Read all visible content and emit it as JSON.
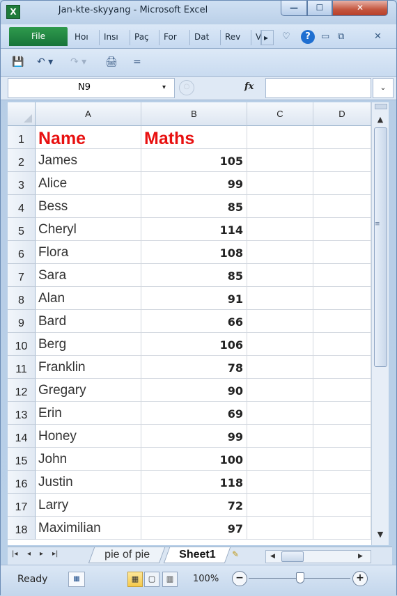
{
  "window": {
    "title": "Jan-kte-skyyang  -  Microsoft Excel",
    "app_icon": "X",
    "min_glyph": "—",
    "max_glyph": "☐",
    "close_glyph": "✕"
  },
  "ribbon": {
    "file_label": "File",
    "tabs": [
      "Hoı",
      "Insı",
      "Paç",
      "For",
      "Dat",
      "Rev",
      "Vı"
    ],
    "tab_more": "▸",
    "minimize_ribbon": "♡",
    "help_glyph": "?",
    "restore_glyphs": [
      "▭",
      "⧉",
      "✕"
    ]
  },
  "qat": {
    "save": "💾",
    "undo": "↶ ▾",
    "redo": "↷ ▾",
    "print": "🖨",
    "customize": "="
  },
  "formula_bar": {
    "name_box": "N9",
    "name_box_arrow": "▾",
    "fx_label": "fx",
    "formula": "",
    "expand_glyph": "⌄",
    "cancel_glyph": "○"
  },
  "columns": [
    "A",
    "B",
    "C",
    "D"
  ],
  "rows": [
    {
      "n": "1",
      "A": "Name",
      "B": "Maths"
    },
    {
      "n": "2",
      "A": "James",
      "B": "105"
    },
    {
      "n": "3",
      "A": "Alice",
      "B": "99"
    },
    {
      "n": "4",
      "A": "Bess",
      "B": "85"
    },
    {
      "n": "5",
      "A": "Cheryl",
      "B": "114"
    },
    {
      "n": "6",
      "A": "Flora",
      "B": "108"
    },
    {
      "n": "7",
      "A": "Sara",
      "B": "85"
    },
    {
      "n": "8",
      "A": "Alan",
      "B": "91"
    },
    {
      "n": "9",
      "A": "Bard",
      "B": "66"
    },
    {
      "n": "10",
      "A": "Berg",
      "B": "106"
    },
    {
      "n": "11",
      "A": "Franklin",
      "B": "78"
    },
    {
      "n": "12",
      "A": "Gregary",
      "B": "90"
    },
    {
      "n": "13",
      "A": "Erin",
      "B": "69"
    },
    {
      "n": "14",
      "A": "Honey",
      "B": "99"
    },
    {
      "n": "15",
      "A": "John",
      "B": "100"
    },
    {
      "n": "16",
      "A": "Justin",
      "B": "118"
    },
    {
      "n": "17",
      "A": "Larry",
      "B": "72"
    },
    {
      "n": "18",
      "A": "Maximilian",
      "B": "97"
    }
  ],
  "sheets": {
    "nav": [
      "|◂",
      "◂",
      "▸",
      "▸|"
    ],
    "inactive": "pie of pie",
    "active": "Sheet1",
    "new_sheet_glyph": "✎"
  },
  "status": {
    "ready": "Ready",
    "macro_glyph": "▦",
    "views": [
      "▦",
      "▢",
      "▥"
    ],
    "zoom": "100%",
    "zoom_minus": "−",
    "zoom_plus": "+"
  }
}
